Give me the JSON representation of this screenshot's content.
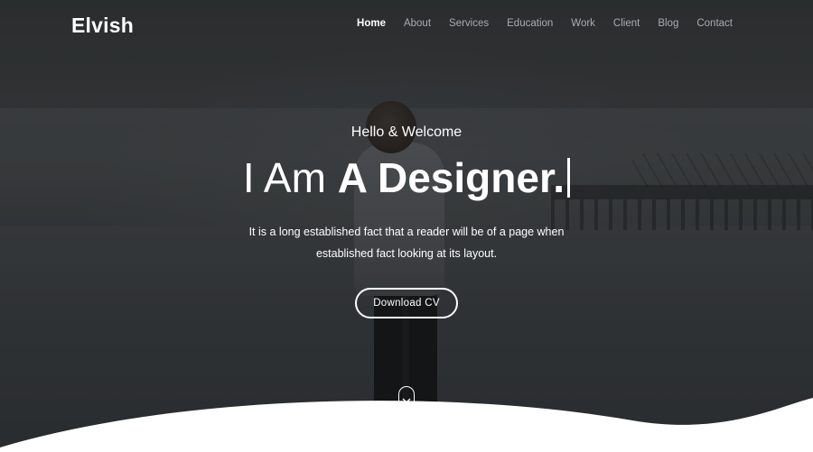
{
  "brand": {
    "name": "Elvish"
  },
  "nav": {
    "items": [
      {
        "label": "Home",
        "active": true
      },
      {
        "label": "About"
      },
      {
        "label": "Services"
      },
      {
        "label": "Education"
      },
      {
        "label": "Work"
      },
      {
        "label": "Client"
      },
      {
        "label": "Blog"
      },
      {
        "label": "Contact"
      }
    ]
  },
  "hero": {
    "greeting": "Hello & Welcome",
    "headline_prefix": "I Am",
    "headline_strong": "A Designer.",
    "description_line1": "It is a long established fact that a reader will be of a page when",
    "description_line2": "established fact looking at its layout.",
    "cta_label": "Download CV",
    "scroll_icon": "chevron-down-icon"
  },
  "colors": {
    "text": "#ffffff",
    "nav_inactive": "#a9adb0",
    "overlay": "#2f3234"
  }
}
